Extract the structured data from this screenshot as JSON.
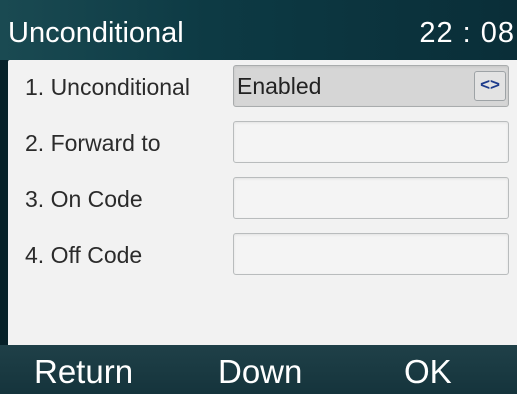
{
  "header": {
    "title": "Unconditional",
    "clock": "22 : 08"
  },
  "form": {
    "rows": [
      {
        "label": "1.  Unconditional",
        "value": "Enabled",
        "switch_icon": "<>"
      },
      {
        "label": "2.  Forward to",
        "value": ""
      },
      {
        "label": "3.  On Code",
        "value": ""
      },
      {
        "label": "4.  Off Code",
        "value": ""
      }
    ]
  },
  "softkeys": {
    "return": "Return",
    "down": "Down",
    "ok": "OK"
  }
}
